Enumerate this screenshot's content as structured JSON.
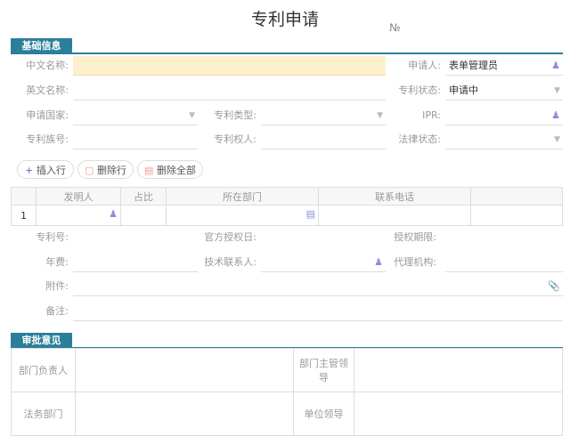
{
  "title": "专利申请",
  "no_label": "№",
  "section_basic": "基础信息",
  "fields": {
    "cn_name": "中文名称:",
    "applicant": "申请人:",
    "applicant_value": "表单管理员",
    "en_name": "英文名称:",
    "status": "专利状态:",
    "status_value": "申请中",
    "country": "申请国家:",
    "type": "专利类型:",
    "ipr": "IPR:",
    "family": "专利族号:",
    "holder": "专利权人:",
    "legal": "法律状态:",
    "patent_no": "专利号:",
    "grant_date": "官方授权日:",
    "term": "授权期限:",
    "fee": "年费:",
    "tech_contact": "技术联系人:",
    "agency": "代理机构:",
    "attachment": "附件:",
    "remark": "备注:"
  },
  "buttons": {
    "insert": "插入行",
    "delete": "删除行",
    "delete_all": "删除全部"
  },
  "grid": {
    "headers": [
      "发明人",
      "占比",
      "所在部门",
      "联系电话"
    ],
    "row_no": "1"
  },
  "section_approval": "审批意见",
  "approval": {
    "dept_head": "部门负责人",
    "dept_leader": "部门主管领导",
    "legal": "法务部门",
    "unit_leader": "单位领导"
  },
  "colors": {
    "accent": "#2a7f9a",
    "required": "#fdf0cc"
  }
}
